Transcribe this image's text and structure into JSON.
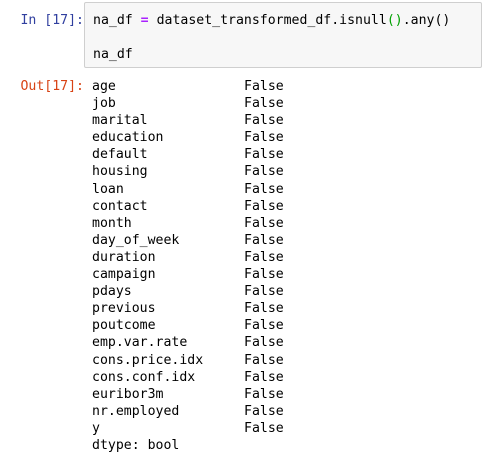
{
  "cell": {
    "in_prompt": "In [17]:",
    "out_prompt": "Out[17]:",
    "code": {
      "line1": {
        "var": "na_df",
        "op": "=",
        "expr": "dataset_transformed_df.isnull",
        "paren1": "()",
        "call2": ".any",
        "paren2": "()"
      },
      "line2": "na_df"
    }
  },
  "output": {
    "rows": [
      {
        "name": "age",
        "value": "False"
      },
      {
        "name": "job",
        "value": "False"
      },
      {
        "name": "marital",
        "value": "False"
      },
      {
        "name": "education",
        "value": "False"
      },
      {
        "name": "default",
        "value": "False"
      },
      {
        "name": "housing",
        "value": "False"
      },
      {
        "name": "loan",
        "value": "False"
      },
      {
        "name": "contact",
        "value": "False"
      },
      {
        "name": "month",
        "value": "False"
      },
      {
        "name": "day_of_week",
        "value": "False"
      },
      {
        "name": "duration",
        "value": "False"
      },
      {
        "name": "campaign",
        "value": "False"
      },
      {
        "name": "pdays",
        "value": "False"
      },
      {
        "name": "previous",
        "value": "False"
      },
      {
        "name": "poutcome",
        "value": "False"
      },
      {
        "name": "emp.var.rate",
        "value": "False"
      },
      {
        "name": "cons.price.idx",
        "value": "False"
      },
      {
        "name": "cons.conf.idx",
        "value": "False"
      },
      {
        "name": "euribor3m",
        "value": "False"
      },
      {
        "name": "nr.employed",
        "value": "False"
      },
      {
        "name": "y",
        "value": "False"
      }
    ],
    "dtype_line": "dtype: bool"
  },
  "colors": {
    "in_prompt": "#303f9f",
    "out_prompt": "#d84315",
    "operator": "#aa22ff",
    "paren": "#00a000",
    "input_bg": "#f7f7f7",
    "input_border": "#cfcfcf"
  }
}
